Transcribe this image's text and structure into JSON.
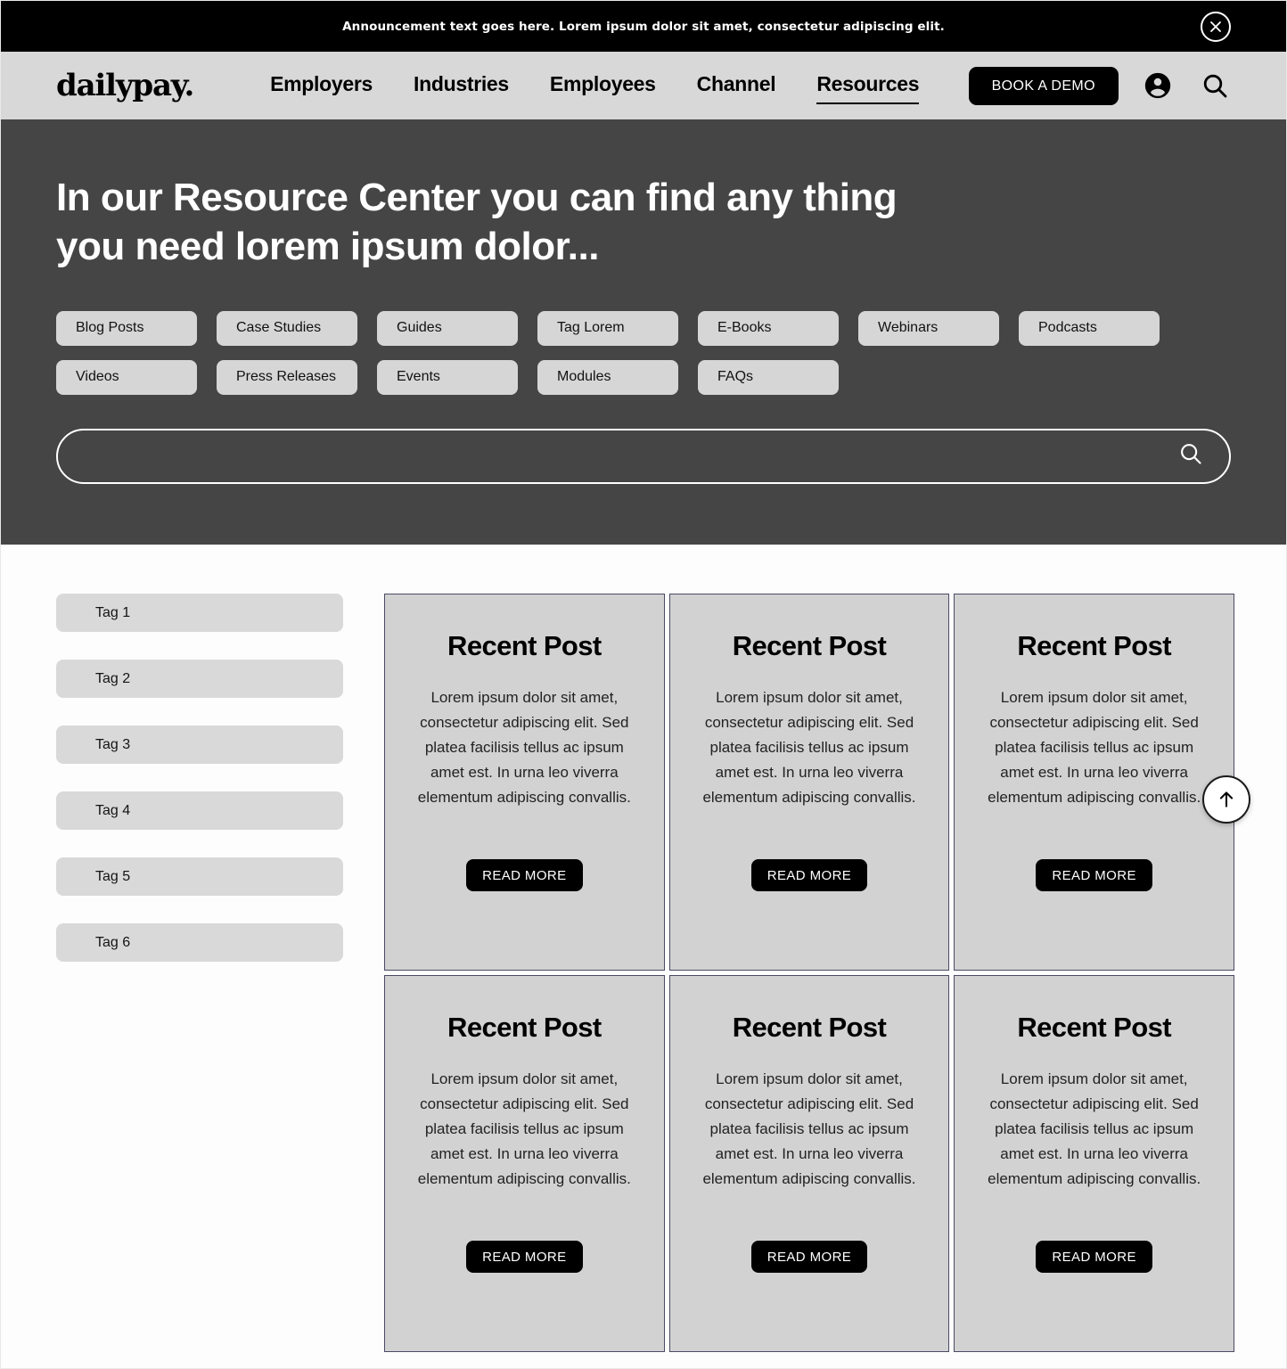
{
  "announcement": {
    "text": "Announcement text goes here. Lorem ipsum dolor sit amet, consectetur adipiscing elit.",
    "close_icon": "close-circle-icon"
  },
  "nav": {
    "logo": "dailypay.",
    "links": [
      {
        "label": "Employers",
        "active": false
      },
      {
        "label": "Industries",
        "active": false
      },
      {
        "label": "Employees",
        "active": false
      },
      {
        "label": "Channel",
        "active": false
      },
      {
        "label": "Resources",
        "active": true
      }
    ],
    "cta_label": "BOOK A DEMO",
    "account_icon": "account-circle-icon",
    "search_icon": "search-icon"
  },
  "hero": {
    "title": "In our Resource Center you can find any thing you need lorem ipsum dolor...",
    "chips_row1": [
      "Blog Posts",
      "Case Studies",
      "Guides",
      "Tag Lorem",
      "E-Books",
      "Webinars",
      "Podcasts"
    ],
    "chips_row2": [
      "Videos",
      "Press Releases",
      "Events",
      "Modules",
      "FAQs"
    ],
    "search": {
      "value": "",
      "placeholder": "",
      "icon": "search-icon"
    }
  },
  "sidebar": {
    "tags": [
      "Tag 1",
      "Tag 2",
      "Tag 3",
      "Tag 4",
      "Tag 5",
      "Tag 6"
    ]
  },
  "cards": [
    {
      "title": "Recent Post",
      "body": "Lorem ipsum dolor sit amet, consectetur adipiscing elit. Sed platea facilisis tellus ac ipsum amet est. In urna leo viverra elementum adipiscing convallis.",
      "button": "READ MORE"
    },
    {
      "title": "Recent Post",
      "body": "Lorem ipsum dolor sit amet, consectetur adipiscing elit. Sed platea facilisis tellus ac ipsum amet est. In urna leo viverra elementum adipiscing convallis.",
      "button": "READ MORE"
    },
    {
      "title": "Recent Post",
      "body": "Lorem ipsum dolor sit amet, consectetur adipiscing elit. Sed platea facilisis tellus ac ipsum amet est. In urna leo viverra elementum adipiscing convallis.",
      "button": "READ MORE"
    },
    {
      "title": "Recent Post",
      "body": "Lorem ipsum dolor sit amet, consectetur adipiscing elit. Sed platea facilisis tellus ac ipsum amet est. In urna leo viverra elementum adipiscing convallis.",
      "button": "READ MORE"
    },
    {
      "title": "Recent Post",
      "body": "Lorem ipsum dolor sit amet, consectetur adipiscing elit. Sed platea facilisis tellus ac ipsum amet est. In urna leo viverra elementum adipiscing convallis.",
      "button": "READ MORE"
    },
    {
      "title": "Recent Post",
      "body": "Lorem ipsum dolor sit amet, consectetur adipiscing elit. Sed platea facilisis tellus ac ipsum amet est. In urna leo viverra elementum adipiscing convallis.",
      "button": "READ MORE"
    }
  ],
  "scroll_top": {
    "icon": "arrow-up-icon"
  },
  "colors": {
    "announcement_bg": "#000000",
    "nav_bg": "#d8d8d8",
    "hero_bg": "#454545",
    "chip_bg": "#d6d6d6",
    "card_bg": "#d2d2d2",
    "card_border": "#4a4a66",
    "accent_black": "#000000",
    "page_bg": "#ffffff"
  }
}
